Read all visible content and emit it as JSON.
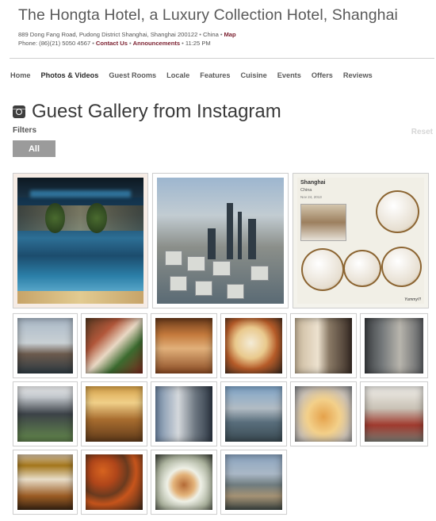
{
  "hotel": {
    "title": "The Hongta Hotel, a Luxury Collection Hotel, Shanghai",
    "address": "889 Dong Fang Road, Pudong District  Shanghai, Shanghai 200122",
    "country": "China",
    "map_link": "Map",
    "phone": "Phone: (86)(21) 5050 4567",
    "contact_link": "Contact Us",
    "announcements_link": "Announcements",
    "time": "11:25 PM"
  },
  "nav": {
    "items": [
      "Home",
      "Photos & Videos",
      "Guest Rooms",
      "Locale",
      "Features",
      "Cuisine",
      "Events",
      "Offers",
      "Reviews"
    ],
    "active": "Photos & Videos"
  },
  "gallery": {
    "title": "Guest Gallery from Instagram",
    "filters_label": "Filters",
    "filter_all": "All",
    "reset": "Reset"
  },
  "photo_overlay": {
    "city": "Shanghai",
    "country": "China",
    "date": "Nov 24, 2013",
    "caption": "Yummy!!!"
  },
  "colors": {
    "accent": "#7a1d2d",
    "filter_button": "#9b9b9b",
    "text": "#5a5a5a"
  }
}
